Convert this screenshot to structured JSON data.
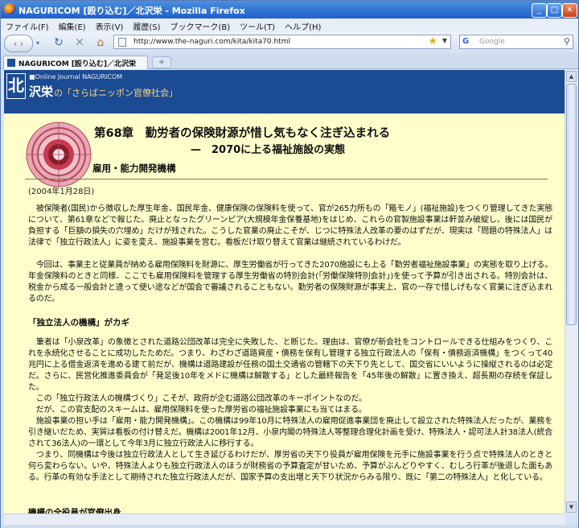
{
  "window": {
    "title": "NAGURICOM [殴り込む]／北沢栄 - Mozilla Firefox",
    "minimize": "_",
    "maximize": "□",
    "close": "✕"
  },
  "menu": [
    "ファイル(F)",
    "編集(E)",
    "表示(V)",
    "履歴(S)",
    "ブックマーク(B)",
    "ツール(T)",
    "ヘルプ(H)"
  ],
  "nav": {
    "back": "‹",
    "forward": "›",
    "reload": "↻",
    "stop": "✕",
    "home": "⌂",
    "url": "http://www.the-naguri.com/kita/kita70.html",
    "search_engine": "G",
    "search_placeholder": "Google",
    "search_icon": "⚲"
  },
  "tabs": [
    {
      "label": "NAGURICOM [殴り込む]／北沢栄"
    }
  ],
  "newtab": "+",
  "banner": {
    "logo_char": "北",
    "publication": "■Online Journal NAGURICOM",
    "author": "沢栄",
    "column": "の「さらばニッポン官僚社会」"
  },
  "article": {
    "chapter_title": "第68章　勤労者の保険財源が惜し気もなく注ぎ込まれる",
    "chapter_subtitle": "—　2070に上る福祉施設の実態",
    "category": "雇用・能力開発機構",
    "date": "(2004年1月28日)",
    "intro": [
      "　被保険者(国民)から徴収した厚生年金、国民年金、健康保険の保険料を使って、官が265力所もの「箱モノ」(福祉施設)をつくり管理してきた実態について、第61章などで報じた。廃止となったグリーンピア(大規模年金保養基地)をはじめ、これらの官製施設事業は軒並み破綻し、後には国民が負担する「巨額の損失の穴埋め」だけが残された。こうした官業の廃止こそが、じつに特殊法人改革の要のはずだが、現実は「問題の特殊法人」は法律で「独立行政法人」に姿を変え、施設事業を営む。看板だけ取り替えて官業は継続されているわけだ。",
      "　今回は、事業主と従業員が納める雇用保険料を財源に、厚生労働省が行ってきた2070施設にも上る「勤労者福祉施設事業」の実態を取り上げる。年金保険料のときと同様、ここでも雇用保険料を管理する厚生労働省の特別会計(「労働保険特別会計」)を使って予算が引き出される。特別会計は、税金から成る一般会計と違って使い途などが国会で審議されることもない。勤労者の保険財源が事実上、官の一存で惜しげもなく官業に注ぎ込まれるのだ。"
    ],
    "section1_heading": "「独立法人の機構」がカギ",
    "section1": [
      "　筆者は「小泉改革」の象徴とされた道路公団改革は完全に失敗した、と断じた。理由は、官僚が新会社をコントロールできる仕組みをつくり、これを永続化させることに成功したためだ。つまり、わざわざ道路資産・債務を保有し管理する独立行政法人の「保有・債務返済機構」をつくって40兆円に上る借金返済を進める建て前だが、機構は道路建設が任務の国土交通省の管轄下の天下り先として、国交省にいいように操縦されるのは必定だ。さらに、民営化推進委員会が「発足後10年をメドに機構は解散する」とした最終報告を「45年後の解散」に置き換え、超長期の存続を保証した。",
      "　この「独立行政法人の機構づくり」こそが、政府が企む道路公団改革のキーポイントなのだ。",
      "　だが、この官支配のスキームは、雇用保険料を使った厚労省の福祉施設事業にも当てはまる。",
      "　施設事業の担い手は「雇用・能力開発機構」。この機構は99年10月に特殊法人の雇用促進事業団を廃止して設立された特殊法人だったが、業務を引き継いだため、実質は看板の付け替えだ。機構は2001年12月、小泉内閣の特殊法人等整理合理化計画を受け、特殊法人・認可法人計38法人(統合されて36法人)の一環として今年3月に独立行政法人に移行する。",
      "　つまり、同機構は今後は独立行政法人として生き延びるわけだが、厚労省の天下り役員が雇用保険を元手に施設事業を行う点で特殊法人のときと何ら変わらない。いや、特殊法人よりも独立行政法人のほうが財務省の予算査定が甘いため、予算がぶんどりやすく、むしろ行革が後退した面もある。行革の有効な手法として期待された独立行政法人だが、国家予算の支出増と天下り状況からみる限り、既に「第二の特殊法人」と化している。"
    ],
    "section2_heading": "機構の全役員が官僚出身"
  },
  "scrollbar": {
    "up": "▲",
    "down": "▼"
  }
}
